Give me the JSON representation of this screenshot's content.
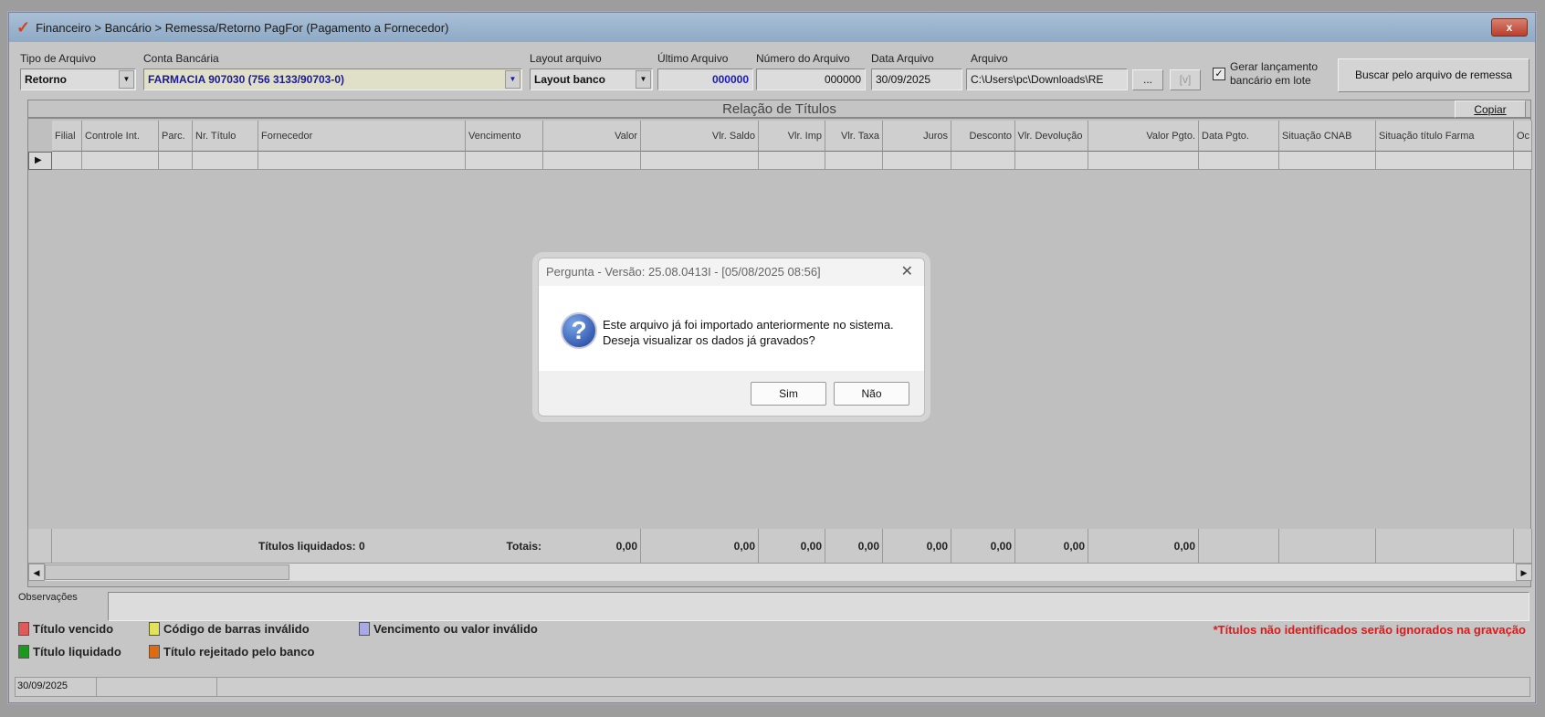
{
  "window": {
    "title": "Financeiro > Bancário > Remessa/Retorno PagFor (Pagamento  a Fornecedor)",
    "close_label": "x"
  },
  "form": {
    "tipo_label": "Tipo de Arquivo",
    "tipo_value": "Retorno",
    "conta_label": "Conta Bancária",
    "conta_value": "FARMACIA 907030 (756 3133/90703-0)",
    "layout_label": "Layout arquivo",
    "layout_value": "Layout banco",
    "ultimo_label": "Último Arquivo",
    "ultimo_value": "000000",
    "numero_label": "Número do Arquivo",
    "numero_value": "000000",
    "data_label": "Data Arquivo",
    "data_value": "30/09/2025",
    "arquivo_label": "Arquivo",
    "arquivo_value": "C:\\Users\\pc\\Downloads\\RE",
    "browse_label": "...",
    "view_label": "[v]",
    "gerar_label_1": "Gerar lançamento",
    "gerar_label_2": "bancário em lote",
    "gerar_checked": true,
    "buscar_label": "Buscar pelo arquivo de remessa"
  },
  "grid": {
    "title": "Relação de Títulos",
    "copy_label": "Copiar",
    "columns": [
      "Filial",
      "Controle Int.",
      "Parc.",
      "Nr. Título",
      "Fornecedor",
      "Vencimento",
      "Valor",
      "Vlr. Saldo",
      "Vlr. Imp",
      "Vlr. Taxa",
      "Juros",
      "Desconto",
      "Vlr. Devolução",
      "Valor Pgto.",
      "Data Pgto.",
      "Situação CNAB",
      "Situação título Farma",
      "Oc"
    ],
    "totals": {
      "liquidados": "Títulos liquidados: 0",
      "totais": "Totais:",
      "values": [
        "0,00",
        "0,00",
        "0,00",
        "0,00",
        "0,00",
        "0,00",
        "0,00",
        "0,00"
      ]
    }
  },
  "obs": {
    "label": "Observações"
  },
  "legend": [
    {
      "label": "Título vencido",
      "color": "#e05a5a"
    },
    {
      "label": "Código de barras inválido",
      "color": "#e3e35a"
    },
    {
      "label": "Vencimento ou valor inválido",
      "color": "#a9a9e6"
    },
    {
      "label": "Título liquidado",
      "color": "#1a9a1a"
    },
    {
      "label": "Título rejeitado pelo banco",
      "color": "#e06a10"
    }
  ],
  "warning": "*Títulos não identificados serão ignorados na gravação",
  "status": {
    "date": "30/09/2025"
  },
  "dialog": {
    "title": "Pergunta - Versão: 25.08.0413I - [05/08/2025 08:56]",
    "line1": "Este arquivo já foi importado anteriormente no sistema.",
    "line2": "Deseja visualizar os dados já gravados?",
    "yes": "Sim",
    "no": "Não"
  }
}
